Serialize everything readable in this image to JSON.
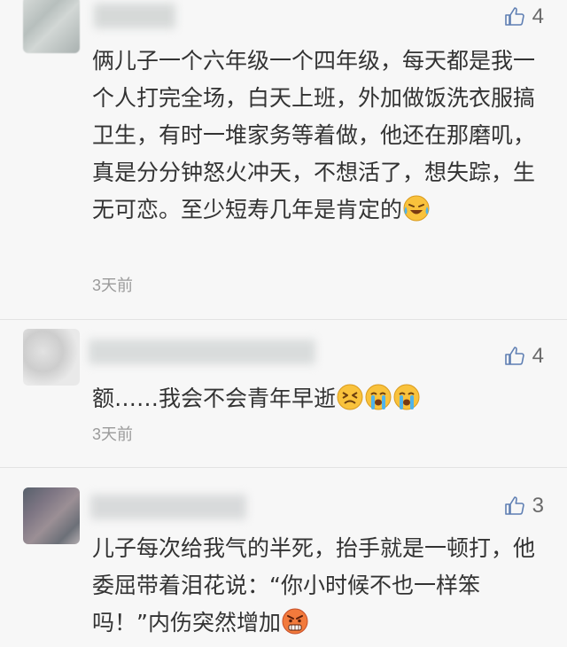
{
  "comments": [
    {
      "likes": "4",
      "text": "俩儿子一个六年级一个四年级，每天都是我一个人打完全场，白天上班，外加做饭洗衣服搞卫生，有时一堆家务等着做，他还在那磨叽，真是分分钟怒火冲天，不想活了，想失踪，生无可恋。至少短寿几年是肯定的",
      "emojis": [
        "laugh-crying-emoji"
      ],
      "time": "3天前"
    },
    {
      "likes": "4",
      "text": "额……我会不会青年早逝",
      "emojis": [
        "persevere-emoji",
        "loudly-crying-emoji",
        "loudly-crying-emoji"
      ],
      "time": "3天前"
    },
    {
      "likes": "3",
      "text": "儿子每次给我气的半死，抬手就是一顿打，他委屈带着泪花说：“你小时候不也一样笨吗！”内伤突然增加",
      "emojis": [
        "angry-emoji"
      ]
    }
  ],
  "colors": {
    "like_icon": "#5f7fb3",
    "text": "#333333",
    "time": "#9b9b9b",
    "background": "#f7f7f7"
  }
}
